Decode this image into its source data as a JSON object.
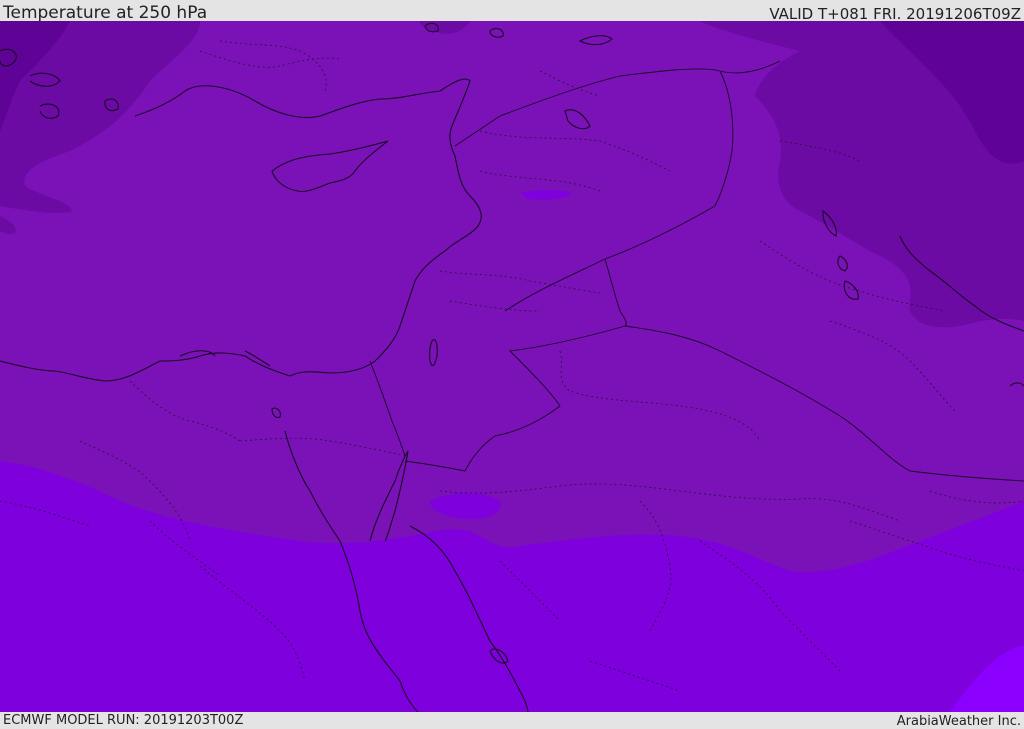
{
  "header": {
    "title": "Temperature at 250 hPa",
    "valid": "VALID T+081 FRI. 20191206T09Z"
  },
  "footer": {
    "model_run": "ECMWF MODEL RUN: 20191203T00Z",
    "credit": "ArabiaWeather Inc."
  },
  "map": {
    "colors": {
      "band_main": "#7a12b8",
      "band_dark": "#6c0aa4",
      "band_darker": "#5e0396",
      "band_south": "#7e00dc",
      "band_warm": "#8c00ff",
      "coastline": "#1a0a24",
      "borders": "#2a1038"
    }
  }
}
